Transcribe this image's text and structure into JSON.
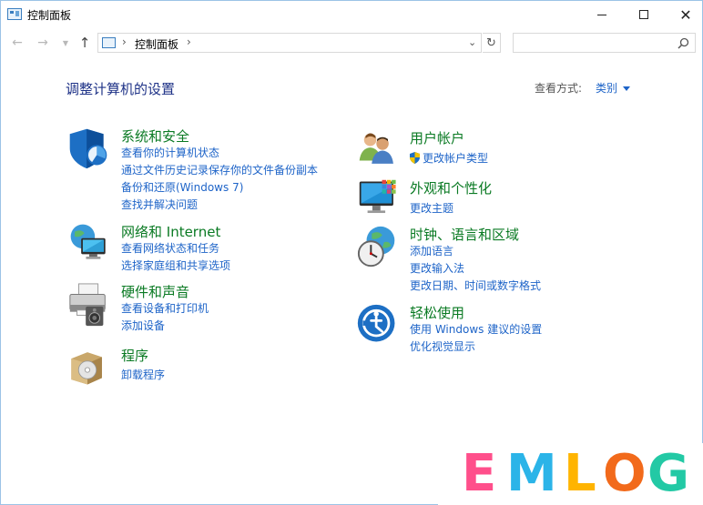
{
  "window": {
    "title": "控制面板",
    "minimize": "—",
    "maximize": "☐",
    "close": "✕"
  },
  "nav": {
    "back": "←",
    "forward": "→",
    "dropdown": "⌄",
    "up": "↑",
    "breadcrumb": "控制面板",
    "refresh": "↻",
    "search_placeholder": ""
  },
  "header": {
    "title": "调整计算机的设置",
    "view_label": "查看方式:",
    "view_value": "类别"
  },
  "categories": [
    {
      "title": "系统和安全",
      "links": [
        "查看你的计算机状态",
        "通过文件历史记录保存你的文件备份副本",
        "备份和还原(Windows 7)",
        "查找并解决问题"
      ]
    },
    {
      "title": "网络和 Internet",
      "links": [
        "查看网络状态和任务",
        "选择家庭组和共享选项"
      ]
    },
    {
      "title": "硬件和声音",
      "links": [
        "查看设备和打印机",
        "添加设备"
      ]
    },
    {
      "title": "程序",
      "links": [
        "卸载程序"
      ]
    },
    {
      "title": "用户帐户",
      "links": [
        "更改帐户类型"
      ]
    },
    {
      "title": "外观和个性化",
      "links": [
        "更改主题"
      ]
    },
    {
      "title": "时钟、语言和区域",
      "links": [
        "添加语言",
        "更改输入法",
        "更改日期、时间或数字格式"
      ]
    },
    {
      "title": "轻松使用",
      "links": [
        "使用 Windows 建议的设置",
        "优化视觉显示"
      ]
    }
  ],
  "watermark": {
    "letters": [
      "E",
      "M",
      "L",
      "O",
      "G"
    ],
    "colors": [
      "#ff4f8b",
      "#2bb4e8",
      "#ffb400",
      "#f26a1b",
      "#23c9a5"
    ]
  },
  "colors": {
    "category_title": "#0a7a23",
    "link": "#1e64c8",
    "page_title": "#1e3287"
  }
}
